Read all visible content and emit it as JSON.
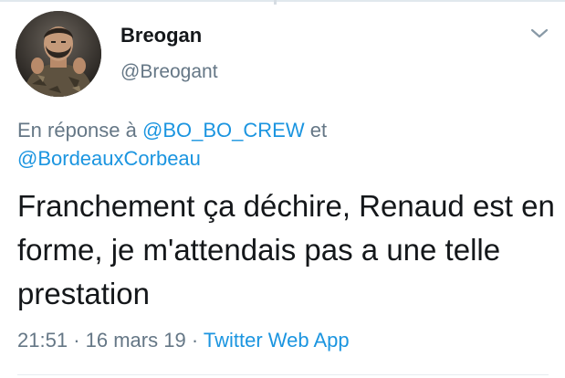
{
  "tweet": {
    "author": {
      "display_name": "Breogan",
      "handle": "@Breogant",
      "avatar": "avatar-photo"
    },
    "menu_icon": "chevron-down-icon",
    "reply_context": {
      "prefix": "En réponse à",
      "mention_1": "@BO_BO_CREW",
      "joiner": "et",
      "mention_2": "@BordeauxCorbeau"
    },
    "text": "Franchement ça déchire, Renaud est en forme, je m'attendais pas a une telle prestation",
    "meta": {
      "time": "21:51",
      "separator": "·",
      "date": "16 mars 19",
      "source": "Twitter Web App"
    }
  },
  "colors": {
    "text": "#14171a",
    "secondary": "#657786",
    "link": "#1b95e0",
    "divider": "#e6ecf0"
  }
}
